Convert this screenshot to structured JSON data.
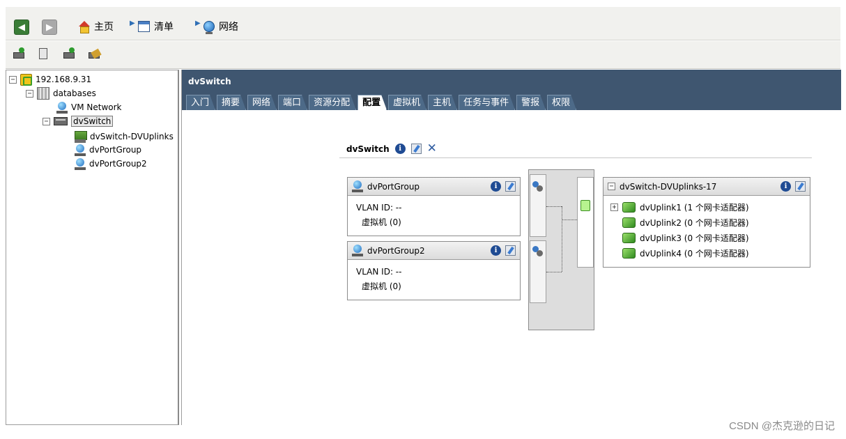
{
  "nav": {
    "back_icon": "back-arrow-icon",
    "forward_icon": "forward-arrow-icon",
    "breadcrumb": [
      {
        "label": "主页",
        "icon": "home-icon"
      },
      {
        "label": "清单",
        "icon": "inventory-icon"
      },
      {
        "label": "网络",
        "icon": "network-icon"
      }
    ]
  },
  "toolbar": {
    "icons": [
      "add-host-icon",
      "new-vm-icon",
      "add-network-icon",
      "edit-settings-icon"
    ]
  },
  "tree": {
    "root": "192.168.9.31",
    "datacenter": "databases",
    "items": {
      "vm_network": "VM Network",
      "dvswitch": "dvSwitch",
      "uplinks": "dvSwitch-DVUplinks",
      "pg1": "dvPortGroup",
      "pg2": "dvPortGroup2"
    },
    "expanders": {
      "collapsed": "+",
      "expanded": "−"
    }
  },
  "content": {
    "title": "dvSwitch",
    "tabs": [
      "入门",
      "摘要",
      "网络",
      "端口",
      "资源分配",
      "配置",
      "虚拟机",
      "主机",
      "任务与事件",
      "警报",
      "权限"
    ],
    "active_tab": "配置"
  },
  "config": {
    "switch_name": "dvSwitch",
    "portgroups": [
      {
        "name": "dvPortGroup",
        "vlan": "VLAN ID: --",
        "vms": "虚拟机 (0)"
      },
      {
        "name": "dvPortGroup2",
        "vlan": "VLAN ID: --",
        "vms": "虚拟机 (0)"
      }
    ],
    "uplink_group": {
      "name": "dvSwitch-DVUplinks-17",
      "uplinks": [
        {
          "label": "dvUplink1 (1 个网卡适配器)",
          "expandable": true
        },
        {
          "label": "dvUplink2 (0 个网卡适配器)",
          "expandable": false
        },
        {
          "label": "dvUplink3 (0 个网卡适配器)",
          "expandable": false
        },
        {
          "label": "dvUplink4 (0 个网卡适配器)",
          "expandable": false
        }
      ]
    },
    "info_glyph": "i",
    "close_glyph": "✕"
  },
  "watermark": "CSDN @杰克逊的日记",
  "colors": {
    "header_bg": "#3f5670",
    "tab_bg": "#4d6a88",
    "panel_head": "#dcdcdc",
    "nav_bg": "#f1f1ee"
  }
}
